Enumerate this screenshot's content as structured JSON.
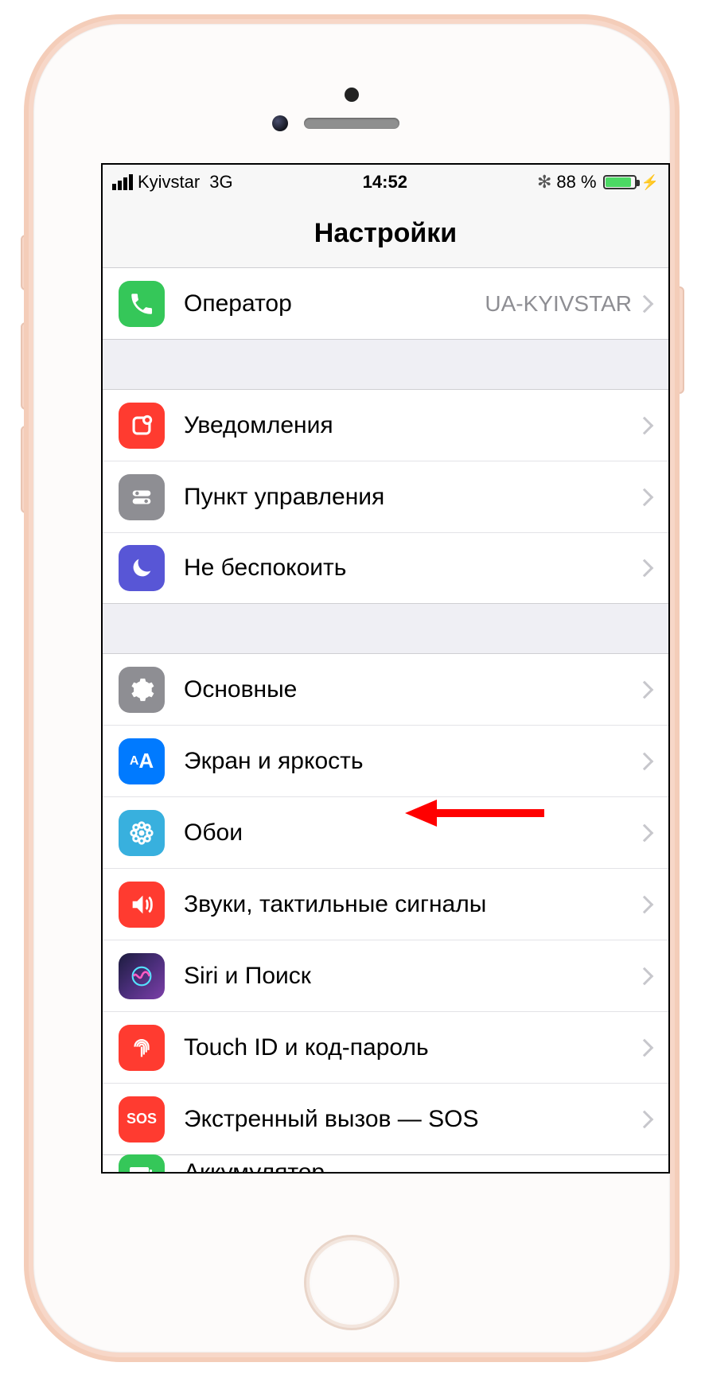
{
  "status": {
    "carrier": "Kyivstar",
    "network": "3G",
    "time": "14:52",
    "battery_pct": "88 %"
  },
  "header": {
    "title": "Настройки"
  },
  "g1": {
    "carrier": {
      "label": "Оператор",
      "value": "UA-KYIVSTAR"
    }
  },
  "g2": {
    "notifications": "Уведомления",
    "control_center": "Пункт управления",
    "dnd": "Не беспокоить"
  },
  "g3": {
    "general": "Основные",
    "display": "Экран и яркость",
    "wallpaper": "Обои",
    "sounds": "Звуки, тактильные сигналы",
    "siri": "Siri и Поиск",
    "touchid": "Touch ID и код-пароль",
    "sos_text": "SOS",
    "sos": "Экстренный вызов — SOS",
    "battery": "Аккумулятор"
  }
}
